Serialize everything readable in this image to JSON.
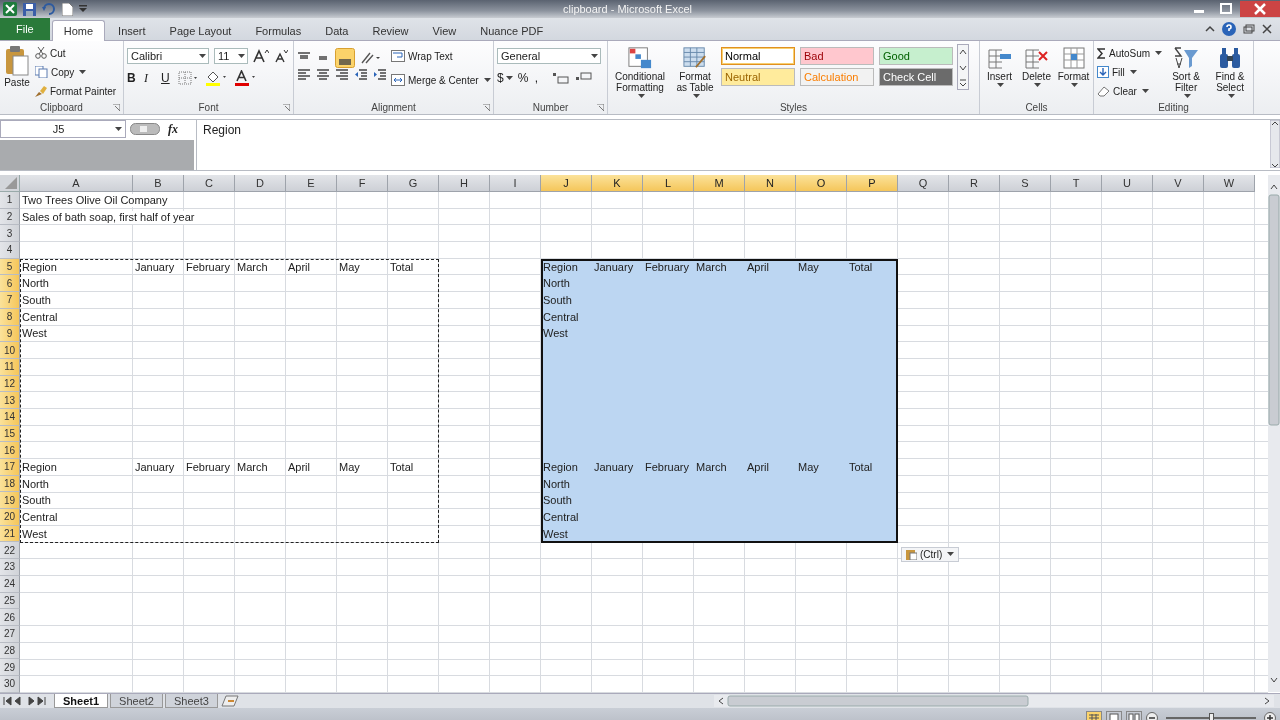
{
  "window": {
    "title": "clipboard - Microsoft Excel"
  },
  "ribbon_tabs": [
    {
      "label": "File",
      "kind": "file",
      "selected": false
    },
    {
      "label": "Home",
      "kind": "tab",
      "selected": true
    },
    {
      "label": "Insert",
      "kind": "tab",
      "selected": false
    },
    {
      "label": "Page Layout",
      "kind": "tab",
      "selected": false
    },
    {
      "label": "Formulas",
      "kind": "tab",
      "selected": false
    },
    {
      "label": "Data",
      "kind": "tab",
      "selected": false
    },
    {
      "label": "Review",
      "kind": "tab",
      "selected": false
    },
    {
      "label": "View",
      "kind": "tab",
      "selected": false
    },
    {
      "label": "Nuance PDF",
      "kind": "tab",
      "selected": false
    }
  ],
  "ribbon": {
    "clipboard": {
      "label": "Clipboard",
      "paste": "Paste",
      "cut": "Cut",
      "copy": "Copy",
      "format_painter": "Format Painter"
    },
    "font": {
      "label": "Font",
      "family": "Calibri",
      "size": "11",
      "bold": "B",
      "italic": "I",
      "underline": "U"
    },
    "alignment": {
      "label": "Alignment",
      "wrap_text": "Wrap Text",
      "merge_center": "Merge & Center"
    },
    "number": {
      "label": "Number",
      "format": "General",
      "currency": "$",
      "percent": "%",
      "comma": ","
    },
    "styles": {
      "label": "Styles",
      "conditional": "Conditional Formatting",
      "format_table": "Format as Table",
      "cell_styles": [
        {
          "label": "Normal",
          "kind": "normal",
          "selected": true
        },
        {
          "label": "Bad",
          "kind": "bad",
          "selected": false
        },
        {
          "label": "Good",
          "kind": "good",
          "selected": false
        },
        {
          "label": "Neutral",
          "kind": "neutral",
          "selected": false
        },
        {
          "label": "Calculation",
          "kind": "calculation",
          "selected": false
        },
        {
          "label": "Check Cell",
          "kind": "check",
          "selected": false
        }
      ]
    },
    "cells": {
      "label": "Cells",
      "insert": "Insert",
      "delete": "Delete",
      "format": "Format"
    },
    "editing": {
      "label": "Editing",
      "autosum": "AutoSum",
      "fill": "Fill",
      "clear": "Clear",
      "sort_filter": "Sort & Filter",
      "find_select": "Find & Select"
    }
  },
  "formula_bar": {
    "name_box": "J5",
    "function_label": "fx",
    "value": "Region"
  },
  "grid": {
    "columns": [
      {
        "label": "A",
        "selected": false
      },
      {
        "label": "B",
        "selected": false
      },
      {
        "label": "C",
        "selected": false
      },
      {
        "label": "D",
        "selected": false
      },
      {
        "label": "E",
        "selected": false
      },
      {
        "label": "F",
        "selected": false
      },
      {
        "label": "G",
        "selected": false
      },
      {
        "label": "H",
        "selected": false
      },
      {
        "label": "I",
        "selected": false
      },
      {
        "label": "J",
        "selected": true
      },
      {
        "label": "K",
        "selected": true
      },
      {
        "label": "L",
        "selected": true
      },
      {
        "label": "M",
        "selected": true
      },
      {
        "label": "N",
        "selected": true
      },
      {
        "label": "O",
        "selected": true
      },
      {
        "label": "P",
        "selected": true
      },
      {
        "label": "Q",
        "selected": false
      },
      {
        "label": "R",
        "selected": false
      },
      {
        "label": "S",
        "selected": false
      },
      {
        "label": "T",
        "selected": false
      },
      {
        "label": "U",
        "selected": false
      },
      {
        "label": "V",
        "selected": false
      },
      {
        "label": "W",
        "selected": false
      }
    ],
    "rows": [
      {
        "label": "1",
        "selected": false,
        "cells": [
          "Two Trees Olive Oil Company"
        ]
      },
      {
        "label": "2",
        "selected": false,
        "cells": [
          "Sales of bath soap, first half of year"
        ]
      },
      {
        "label": "3",
        "selected": false,
        "cells": []
      },
      {
        "label": "4",
        "selected": false,
        "cells": []
      },
      {
        "label": "5",
        "selected": true,
        "cells": [
          "Region",
          "January",
          "February",
          "March",
          "April",
          "May",
          "Total",
          null,
          null,
          "Region",
          "January",
          "February",
          "March",
          "April",
          "May",
          "Total"
        ]
      },
      {
        "label": "6",
        "selected": true,
        "cells": [
          "North",
          null,
          null,
          null,
          null,
          null,
          null,
          null,
          null,
          "North"
        ]
      },
      {
        "label": "7",
        "selected": true,
        "cells": [
          "South",
          null,
          null,
          null,
          null,
          null,
          null,
          null,
          null,
          "South"
        ]
      },
      {
        "label": "8",
        "selected": true,
        "cells": [
          "Central",
          null,
          null,
          null,
          null,
          null,
          null,
          null,
          null,
          "Central"
        ]
      },
      {
        "label": "9",
        "selected": true,
        "cells": [
          "West",
          null,
          null,
          null,
          null,
          null,
          null,
          null,
          null,
          "West"
        ]
      },
      {
        "label": "10",
        "selected": true,
        "cells": []
      },
      {
        "label": "11",
        "selected": true,
        "cells": []
      },
      {
        "label": "12",
        "selected": true,
        "cells": []
      },
      {
        "label": "13",
        "selected": true,
        "cells": []
      },
      {
        "label": "14",
        "selected": true,
        "cells": []
      },
      {
        "label": "15",
        "selected": true,
        "cells": []
      },
      {
        "label": "16",
        "selected": true,
        "cells": []
      },
      {
        "label": "17",
        "selected": true,
        "cells": [
          "Region",
          "January",
          "February",
          "March",
          "April",
          "May",
          "Total",
          null,
          null,
          "Region",
          "January",
          "February",
          "March",
          "April",
          "May",
          "Total"
        ]
      },
      {
        "label": "18",
        "selected": true,
        "cells": [
          "North",
          null,
          null,
          null,
          null,
          null,
          null,
          null,
          null,
          "North"
        ]
      },
      {
        "label": "19",
        "selected": true,
        "cells": [
          "South",
          null,
          null,
          null,
          null,
          null,
          null,
          null,
          null,
          "South"
        ]
      },
      {
        "label": "20",
        "selected": true,
        "cells": [
          "Central",
          null,
          null,
          null,
          null,
          null,
          null,
          null,
          null,
          "Central"
        ]
      },
      {
        "label": "21",
        "selected": true,
        "cells": [
          "West",
          null,
          null,
          null,
          null,
          null,
          null,
          null,
          null,
          "West"
        ]
      },
      {
        "label": "22",
        "selected": false,
        "cells": []
      },
      {
        "label": "23",
        "selected": false,
        "cells": []
      },
      {
        "label": "24",
        "selected": false,
        "cells": []
      },
      {
        "label": "25",
        "selected": false,
        "cells": []
      },
      {
        "label": "26",
        "selected": false,
        "cells": []
      },
      {
        "label": "27",
        "selected": false,
        "cells": []
      },
      {
        "label": "28",
        "selected": false,
        "cells": []
      },
      {
        "label": "29",
        "selected": false,
        "cells": []
      },
      {
        "label": "30",
        "selected": false,
        "cells": []
      }
    ]
  },
  "paste_options": {
    "label": "(Ctrl)"
  },
  "sheet_tabs": [
    {
      "label": "Sheet1",
      "selected": true
    },
    {
      "label": "Sheet2",
      "selected": false
    },
    {
      "label": "Sheet3",
      "selected": false
    }
  ],
  "status_bar": {
    "views": [
      {
        "kind": "normal",
        "selected": true
      },
      {
        "kind": "layout",
        "selected": false
      },
      {
        "kind": "break",
        "selected": false
      }
    ],
    "zoom": {
      "level": 0.5
    }
  }
}
